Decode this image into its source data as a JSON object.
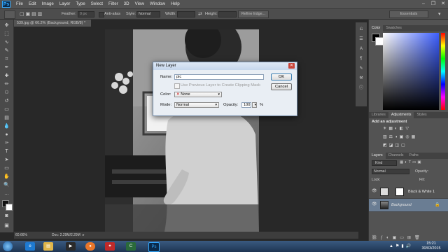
{
  "app": {
    "logo": "Ps"
  },
  "menu": [
    "File",
    "Edit",
    "Image",
    "Layer",
    "Type",
    "Select",
    "Filter",
    "3D",
    "View",
    "Window",
    "Help"
  ],
  "window_controls": {
    "minimize": "–",
    "restore": "❐",
    "close": "✕"
  },
  "options_bar": {
    "feather_label": "Feather:",
    "feather_value": "0 px",
    "antialias_label": "Anti-alias",
    "style_label": "Style:",
    "style_value": "Normal",
    "width_label": "Width:",
    "height_label": "Height:",
    "refine_edge": "Refine Edge...",
    "workspace": "Essentials"
  },
  "document": {
    "tab_title": "539.jpg @ 60.2% (Background, RGB/8) *",
    "tab_close": "×"
  },
  "status_bar": {
    "zoom": "60.66%",
    "doc": "Doc: 2.29M/2.29M"
  },
  "panels": {
    "color_tabs": [
      "Color",
      "Swatches"
    ],
    "adjust_tabs": [
      "Libraries",
      "Adjustments",
      "Styles"
    ],
    "adjust_title": "Add an adjustment",
    "layers_tabs": [
      "Layers",
      "Channels",
      "Paths"
    ],
    "kind_label": "Kind",
    "blend_mode": "Normal",
    "opacity_label": "Opacity:",
    "lock_label": "Lock:",
    "fill_label": "Fill:",
    "layers": [
      {
        "name": "Black & White 1"
      },
      {
        "name": "Background"
      }
    ]
  },
  "dialog": {
    "title": "New Layer",
    "close": "✕",
    "name_label": "Name:",
    "name_value": "pic",
    "clipping_label": "Use Previous Layer to Create Clipping Mask",
    "color_label": "Color:",
    "color_value": "None",
    "mode_label": "Mode:",
    "mode_value": "Normal",
    "opacity_label": "Opacity:",
    "opacity_value": "100",
    "opacity_unit": "%",
    "ok": "OK",
    "cancel": "Cancel"
  },
  "taskbar": {
    "time": "15:21",
    "date": "30/03/2015"
  },
  "colors": {
    "accent": "#31a8ff",
    "panel": "#535353",
    "canvas_bg": "#282828",
    "dialog_bg": "#e9eef4"
  }
}
